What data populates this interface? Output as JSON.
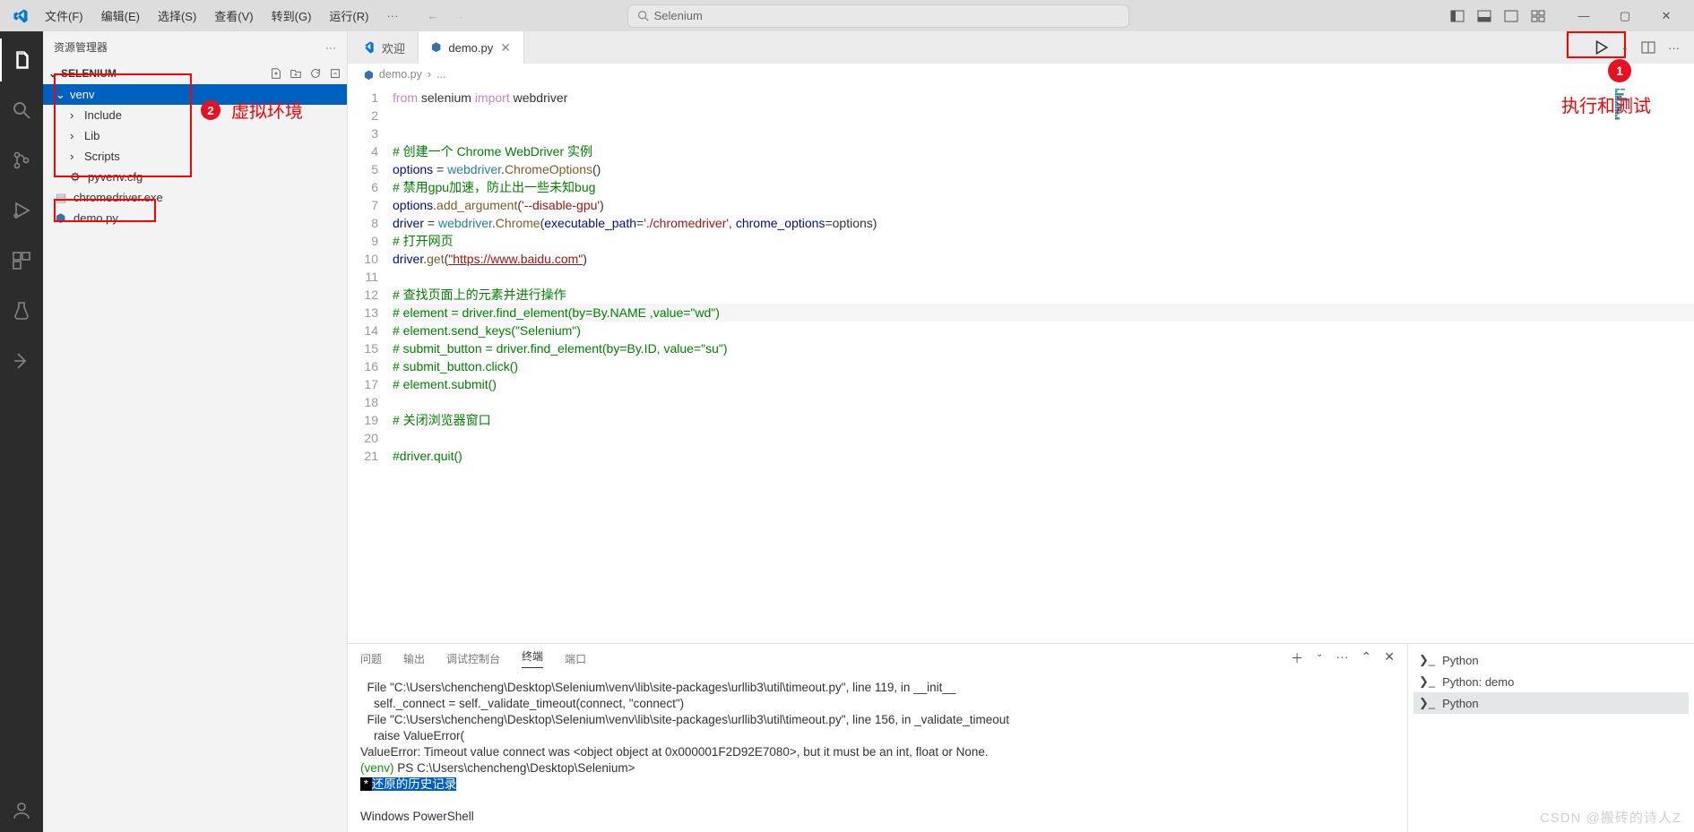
{
  "title_bar": {
    "menus": [
      "文件(F)",
      "编辑(E)",
      "选择(S)",
      "查看(V)",
      "转到(G)",
      "运行(R)"
    ],
    "search_text": "Selenium"
  },
  "sidebar": {
    "header": "资源管理器",
    "section": "SELENIUM",
    "tree": {
      "venv": "venv",
      "include": "Include",
      "lib": "Lib",
      "scripts": "Scripts",
      "pyvenv": "pyvenv.cfg",
      "chromedriver": "chromedriver.exe",
      "demo": "demo.py"
    }
  },
  "tabs": {
    "welcome": "欢迎",
    "demo": "demo.py"
  },
  "breadcrumb": {
    "file": "demo.py",
    "sep": "›",
    "more": "..."
  },
  "code": {
    "l1a": "from",
    "l1b": " selenium ",
    "l1c": "import",
    "l1d": " webdriver",
    "l4": "# 创建一个 Chrome WebDriver 实例",
    "l5a": "options",
    "l5b": " = ",
    "l5c": "webdriver",
    "l5d": ".",
    "l5e": "ChromeOptions",
    "l5f": "()",
    "l6": "# 禁用gpu加速，防止出一些未知bug",
    "l7a": "options",
    "l7b": ".",
    "l7c": "add_argument",
    "l7d": "(",
    "l7e": "'--disable-gpu'",
    "l7f": ")",
    "l8a": "driver",
    "l8b": " = ",
    "l8c": "webdriver",
    "l8d": ".",
    "l8e": "Chrome",
    "l8f": "(",
    "l8g": "executable_path",
    "l8h": "=",
    "l8i": "'./chromedriver'",
    "l8j": ", ",
    "l8k": "chrome_options",
    "l8l": "=options)",
    "l9": "# 打开网页",
    "l10a": "driver",
    "l10b": ".",
    "l10c": "get",
    "l10d": "(",
    "l10e": "\"https://www.baidu.com\"",
    "l10f": ")",
    "l12": "# 查找页面上的元素并进行操作",
    "l13": "# element = driver.find_element(by=By.NAME ,value=\"wd\")",
    "l14": "# element.send_keys(\"Selenium\")",
    "l15": "# submit_button = driver.find_element(by=By.ID, value=\"su\")",
    "l16": "# submit_button.click()",
    "l17": "# element.submit()",
    "l19": "# 关闭浏览器窗口",
    "l21": "#driver.quit()"
  },
  "line_numbers": [
    "1",
    "2",
    "3",
    "4",
    "5",
    "6",
    "7",
    "8",
    "9",
    "10",
    "11",
    "12",
    "13",
    "14",
    "15",
    "16",
    "17",
    "18",
    "19",
    "20",
    "21"
  ],
  "panel": {
    "tabs": {
      "problems": "问题",
      "output": "输出",
      "debug": "调试控制台",
      "terminal": "终端",
      "ports": "端口"
    },
    "terminal_text": "  File \"C:\\Users\\chencheng\\Desktop\\Selenium\\venv\\lib\\site-packages\\urllib3\\util\\timeout.py\", line 119, in __init__\n    self._connect = self._validate_timeout(connect, \"connect\")\n  File \"C:\\Users\\chencheng\\Desktop\\Selenium\\venv\\lib\\site-packages\\urllib3\\util\\timeout.py\", line 156, in _validate_timeout\n    raise ValueError(\nValueError: Timeout value connect was <object object at 0x000001F2D92E7080>, but it must be an int, float or None.",
    "prompt_venv": "(venv) ",
    "prompt_path": "PS C:\\Users\\chencheng\\Desktop\\Selenium>",
    "history_star": " * ",
    "history": "还原的历史记录",
    "ps_label": "Windows PowerShell",
    "side": {
      "p1": "Python",
      "p2": "Python: demo",
      "p3": "Python"
    }
  },
  "annotations": {
    "n1": "1",
    "n1_text": "执行和测试",
    "n2": "2",
    "n2_text": "虚拟环境"
  },
  "watermark": "CSDN @搬砖的诗人Z"
}
